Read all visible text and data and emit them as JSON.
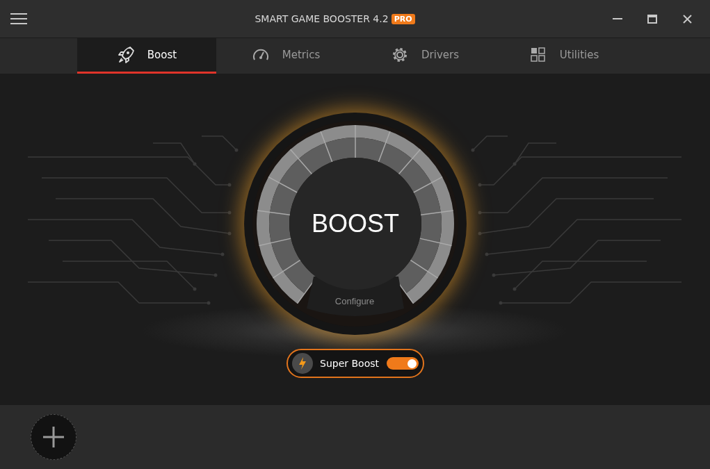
{
  "window": {
    "title": "SMART GAME BOOSTER 4.2",
    "badge": "PRO"
  },
  "tabs": [
    {
      "label": "Boost",
      "selected": true
    },
    {
      "label": "Metrics",
      "selected": false
    },
    {
      "label": "Drivers",
      "selected": false
    },
    {
      "label": "Utilities",
      "selected": false
    }
  ],
  "boost": {
    "label": "BOOST",
    "configure": "Configure"
  },
  "super_boost": {
    "label": "Super Boost",
    "on": true
  }
}
